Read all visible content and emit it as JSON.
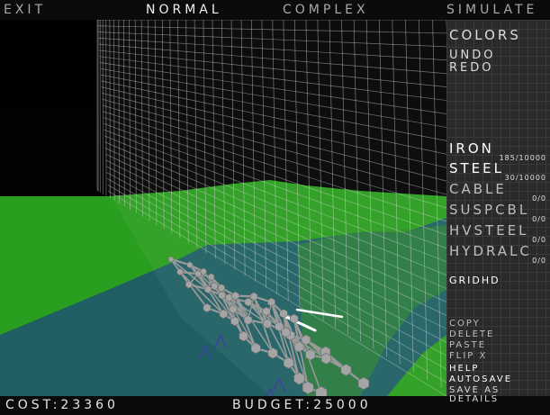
{
  "topbar": {
    "exit": "Exit",
    "normal": "Normal",
    "complex": "Complex",
    "simulate": "Simulate"
  },
  "panel": {
    "colors": "Colors",
    "undo": "Undo",
    "redo": "Redo",
    "materials": [
      {
        "name": "Iron",
        "count": "185/10000"
      },
      {
        "name": "Steel",
        "count": "30/10000"
      },
      {
        "name": "Cable",
        "count": "0/0"
      },
      {
        "name": "SuspCbl",
        "count": "0/0"
      },
      {
        "name": "HvSteel",
        "count": "0/0"
      },
      {
        "name": "HydrAlc",
        "count": "0/0"
      }
    ],
    "grid": "GridHD",
    "copy": "Copy",
    "delete": "Delete",
    "paste": "Paste",
    "flip_x": "Flip X",
    "help": "Help",
    "autosave": "Autosave",
    "save_as": "Save As",
    "details": "Details"
  },
  "bottombar": {
    "cost_label": "Cost:",
    "cost": "23360",
    "budget_label": "Budget:",
    "budget": "25000"
  },
  "colors": {
    "ground": "#2a9e1e",
    "water": "#1f5f63",
    "grid": "#d8d8d8",
    "beam": "#9a9a9a",
    "node": "#a5a5a5",
    "selected": "#ffffff",
    "support": "#4040a0"
  }
}
